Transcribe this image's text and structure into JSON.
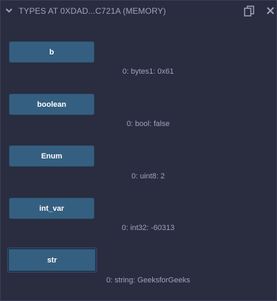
{
  "header": {
    "title": "TYPES AT 0XDAD...C721A (MEMORY)"
  },
  "icons": {
    "collapse": "chevron-down-icon",
    "copy": "copy-icon",
    "close": "close-icon"
  },
  "functions": [
    {
      "label": "b",
      "result": "0: bytes1: 0x61"
    },
    {
      "label": "boolean",
      "result": "0: bool: false"
    },
    {
      "label": "Enum",
      "result": "0: uint8: 2"
    },
    {
      "label": "int_var",
      "result": "0: int32: -60313"
    },
    {
      "label": "str",
      "result": "0: string: GeeksforGeeks"
    }
  ],
  "colors": {
    "background": "#2a2c3f",
    "button": "#355f80",
    "text_muted": "#a2a3bd"
  }
}
